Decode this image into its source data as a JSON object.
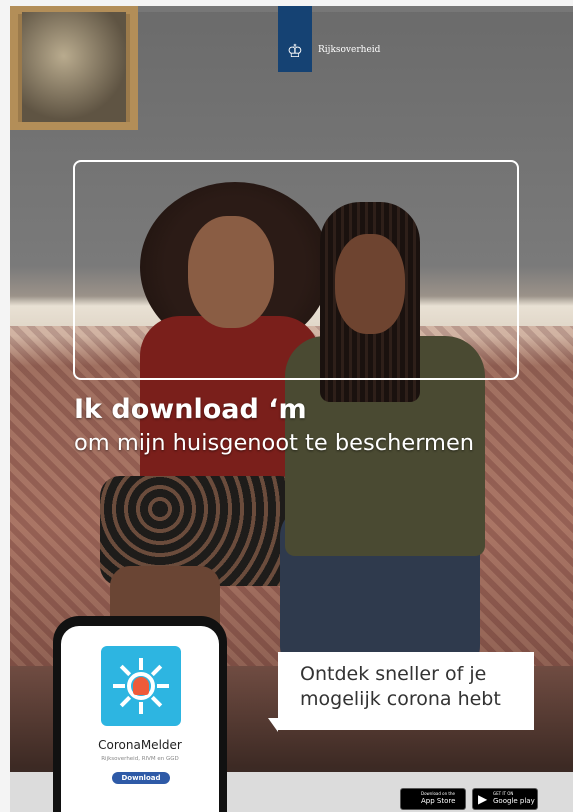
{
  "logo": {
    "emblem_icon": "coat-of-arms-icon",
    "text": "Rijksoverheid"
  },
  "headline": "Ik download ‘m",
  "subline": "om mijn huisgenoot te beschermen",
  "phone": {
    "app_icon": "corona-melder-icon",
    "app_name": "CoronaMelder",
    "publisher": "Rijksoverheid, RIVM en GGD",
    "download_label": "Download"
  },
  "bubble": {
    "line1": "Ontdek sneller of je",
    "line2": "mogelijk corona hebt"
  },
  "stores": {
    "apple": {
      "small": "Download on the",
      "big": "App Store",
      "icon": "apple-icon"
    },
    "google": {
      "small": "GET IT ON",
      "big": "Google play",
      "icon": "google-play-icon"
    }
  },
  "colors": {
    "brand_blue": "#154273",
    "app_blue": "#2db5e1",
    "bell_red": "#ee5b3a",
    "button_blue": "#2e5aa7"
  }
}
